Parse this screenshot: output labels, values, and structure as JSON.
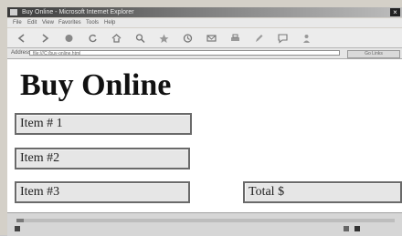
{
  "window": {
    "title": "Buy Online - Microsoft Internet Explorer"
  },
  "menu": [
    "File",
    "Edit",
    "View",
    "Favorites",
    "Tools",
    "Help"
  ],
  "toolbar": {
    "buttons": [
      "back",
      "forward",
      "stop",
      "refresh",
      "home",
      "search",
      "favorites",
      "history",
      "mail",
      "print",
      "edit",
      "discuss"
    ]
  },
  "address": {
    "label": "Address",
    "value": "file:///C:/buy-online.html",
    "go_label": "Go  Links"
  },
  "page": {
    "title": "Buy Online",
    "fields": {
      "item1": "Item # 1",
      "item2": "Item #2",
      "item3": "Item #3",
      "total": "Total $"
    }
  },
  "status": {
    "progress": 0.02
  }
}
